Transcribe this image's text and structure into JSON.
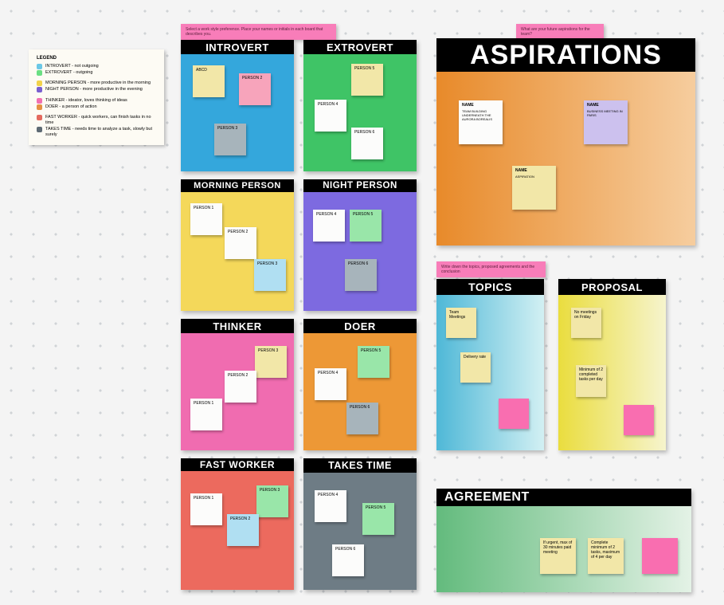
{
  "legend": {
    "title": "LEGEND",
    "items": [
      "INTROVERT - not outgoing",
      "EXTROVERT - outgoing",
      "MORNING PERSON - more productive in the morning",
      "NIGHT PERSON - more productive in the evening",
      "THINKER - ideator, loves thinking of ideas",
      "DOER - a person of action",
      "FAST WORKER - quick workers, can finish tasks in no time",
      "TAKES TIME - needs time to analyze a task, slowly but surely"
    ]
  },
  "labels": {
    "work_style": "Select a work style preference. Place your names or initials in each board that describes you.",
    "aspirations_prompt": "What are your future aspirations for the team?",
    "topics_prompt": "Write down the topics, proposed agreements and the conclusion"
  },
  "boards": {
    "introvert": {
      "title": "INTROVERT",
      "notes": [
        "ABCD",
        "PERSON 2",
        "PERSON 3"
      ]
    },
    "extrovert": {
      "title": "EXTROVERT",
      "notes": [
        "PERSON 5",
        "PERSON 4",
        "PERSON 6"
      ]
    },
    "morning": {
      "title": "MORNING PERSON",
      "notes": [
        "PERSON 1",
        "PERSON 2",
        "PERSON 3"
      ]
    },
    "night": {
      "title": "NIGHT PERSON",
      "notes": [
        "PERSON 4",
        "PERSON 5",
        "PERSON 6"
      ]
    },
    "thinker": {
      "title": "THINKER",
      "notes": [
        "PERSON 3",
        "PERSON 2",
        "PERSON 1"
      ]
    },
    "doer": {
      "title": "DOER",
      "notes": [
        "PERSON 5",
        "PERSON 4",
        "PERSON 6"
      ]
    },
    "fast": {
      "title": "FAST WORKER",
      "notes": [
        "PERSON 3",
        "PERSON 1",
        "PERSON 2"
      ]
    },
    "takes": {
      "title": "TAKES TIME",
      "notes": [
        "PERSON 4",
        "PERSON 5",
        "PERSON 6"
      ]
    },
    "aspirations": {
      "title": "ASPIRATIONS",
      "card1": {
        "name": "NAME",
        "body": "TEAM BUILDING UNDERNEATH THE AURORA BOREALIS"
      },
      "card2": {
        "name": "NAME",
        "body": "BUSINESS MEETING IN PARIS"
      },
      "card3": {
        "name": "NAME",
        "body": "ASPIRATION"
      }
    },
    "topics": {
      "title": "TOPICS",
      "notes": [
        "Team Meetings",
        "Delivery rate"
      ]
    },
    "proposal": {
      "title": "PROPOSAL",
      "notes": [
        "No meetings on Friday",
        "Minimum of 2 completed tasks per day"
      ]
    },
    "agreement": {
      "title": "AGREEMENT",
      "notes": [
        "If urgent, max of 30 minutes paid meeting",
        "Complete minimum of 2 tasks, maximum of 4 per day"
      ]
    }
  }
}
